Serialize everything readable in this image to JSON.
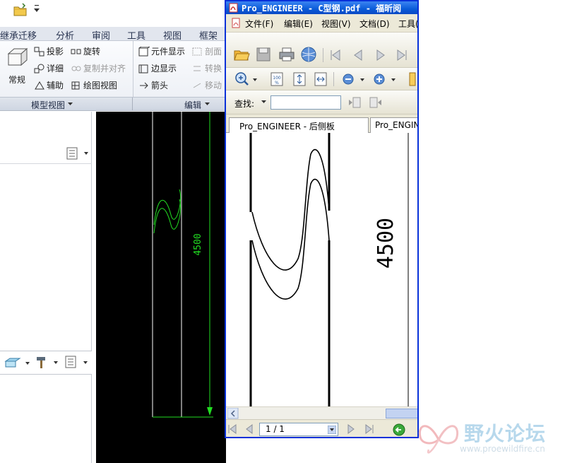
{
  "creo": {
    "menu": [
      "继承迁移",
      "分析",
      "审阅",
      "工具",
      "视图",
      "框架"
    ],
    "ribbon": {
      "large_button": "常规",
      "col1": [
        "投影",
        "详细",
        "辅助"
      ],
      "col2": [
        "旋转",
        "复制并对齐",
        "绘图视图"
      ],
      "col3": [
        "元件显示",
        "边显示",
        "箭头"
      ],
      "col4": [
        "剖面",
        "转换",
        "移动"
      ]
    },
    "groups": [
      "模型视图",
      "编辑"
    ],
    "drawing": {
      "dimension": "4500"
    }
  },
  "foxit": {
    "title": "Pro_ENGINEER - C型钢.pdf - 福昕阅",
    "menu": [
      "文件(F)",
      "编辑(E)",
      "视图(V)",
      "文档(D)",
      "工具("
    ],
    "find_label": "查找:",
    "find_placeholder": "",
    "tabs": [
      "Pro_ENGINEER - 后侧板",
      "Pro_ENGIN"
    ],
    "page_indicator": "1 / 1",
    "drawing_dimension": "4500"
  },
  "watermark": {
    "name": "野火论坛",
    "url": "www.proewildfire.cn"
  },
  "colors": {
    "canvas_bg": "#000000",
    "dimension_green": "#22dd22",
    "title_blue": "#0a5bd8"
  }
}
